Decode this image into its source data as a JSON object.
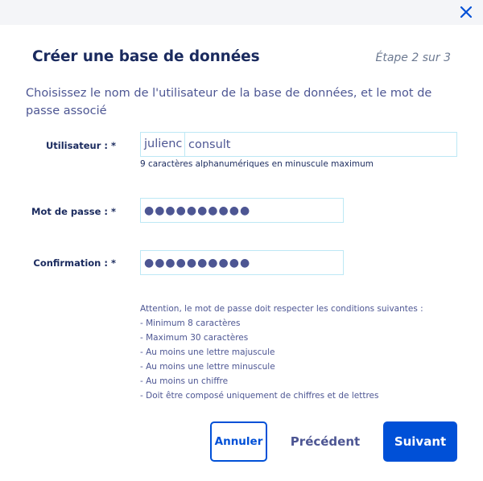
{
  "dialog": {
    "title": "Créer une base de données",
    "step": "Étape 2 sur 3",
    "intro": "Choisissez le nom de l'utilisateur de la base de données, et le mot de passe associé",
    "close_icon": "close-icon"
  },
  "form": {
    "user": {
      "label": "Utilisateur : *",
      "prefix": "julienc",
      "value": "consult",
      "hint": "9 caractères alphanumériques en minuscule maximum"
    },
    "password": {
      "label": "Mot de passe : *",
      "value": "●●●●●●●●●●"
    },
    "confirm": {
      "label": "Confirmation : *",
      "value": "●●●●●●●●●●"
    },
    "rules": [
      "Attention, le mot de passe doit respecter les conditions suivantes :",
      "- Minimum 8 caractères",
      "- Maximum 30 caractères",
      "- Au moins une lettre majuscule",
      "- Au moins une lettre minuscule",
      "- Au moins un chiffre",
      "- Doit être composé uniquement de chiffres et de lettres"
    ]
  },
  "buttons": {
    "cancel": "Annuler",
    "previous": "Précédent",
    "next": "Suivant"
  },
  "colors": {
    "accent": "#0050d7",
    "title": "#1a2a5e",
    "text": "#4d5693",
    "input_border": "#bde8f5"
  }
}
